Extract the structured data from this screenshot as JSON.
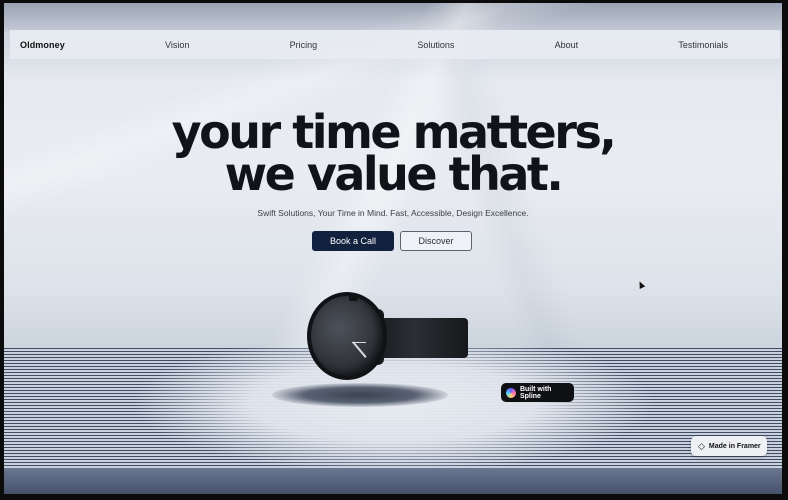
{
  "nav": {
    "brand": "Oldmoney",
    "items": [
      "Vision",
      "Pricing",
      "Solutions",
      "About",
      "Testimonials"
    ]
  },
  "hero": {
    "title_line1": "your time matters,",
    "title_line2": "we value that.",
    "subtitle": "Swift Solutions, Your Time in Mind. Fast, Accessible, Design Excellence."
  },
  "buttons": {
    "primary": "Book a Call",
    "secondary": "Discover"
  },
  "badges": {
    "spline": "Built with Spline",
    "framer": "Made in Framer"
  },
  "colors": {
    "primary_button": "#12223e",
    "title_text": "#121318"
  }
}
